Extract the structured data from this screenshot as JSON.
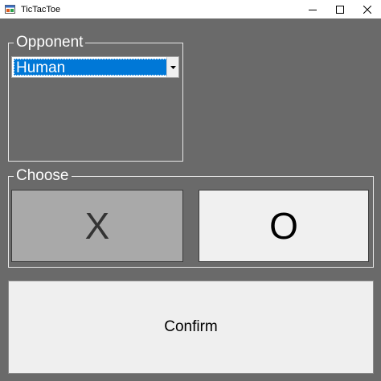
{
  "window": {
    "title": "TicTacToe",
    "icon": "app-icon",
    "controls": [
      "minimize-icon",
      "maximize-icon",
      "close-icon"
    ]
  },
  "opponent": {
    "legend": "Opponent",
    "selected": "Human"
  },
  "choose": {
    "legend": "Choose",
    "x_label": "X",
    "o_label": "O"
  },
  "confirm": {
    "label": "Confirm"
  },
  "colors": {
    "background": "#6a6a6a",
    "selection": "#0078d7",
    "selected_choice": "#a9a9a9",
    "button_face": "#f0f0f0"
  }
}
